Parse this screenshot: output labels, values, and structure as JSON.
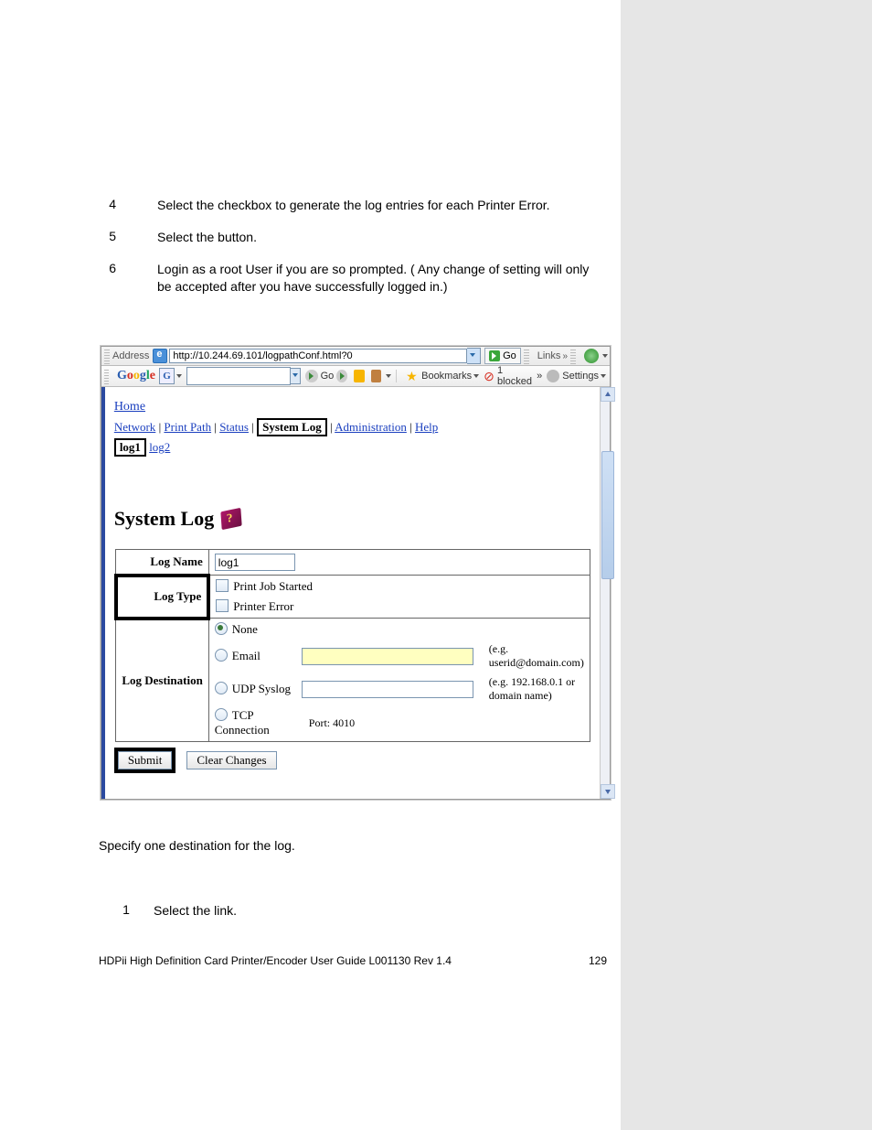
{
  "steps": [
    {
      "num": "4",
      "text_a": "Select the ",
      "text_b": " checkbox to generate the log entries for each Printer Error."
    },
    {
      "num": "5",
      "text_a": "Select the ",
      "text_b": " button."
    },
    {
      "num": "6",
      "text_a": "Login as a root User if you are so prompted. (",
      "text_b": " Any change of setting will only be accepted after you have successfully logged in.)"
    }
  ],
  "browser": {
    "address_label": "Address",
    "url": "http://10.244.69.101/logpathConf.html?0",
    "go": "Go",
    "links": "Links",
    "google": {
      "g": "G",
      "o1": "o",
      "o2": "o",
      "g2": "g",
      "l": "l",
      "e": "e"
    },
    "toolbar": {
      "go": "Go",
      "bookmarks": "Bookmarks",
      "blocked": "1 blocked",
      "settings": "Settings"
    }
  },
  "page": {
    "home": "Home",
    "nav": {
      "network": "Network",
      "printpath": "Print Path",
      "status": "Status",
      "systemlog": "System Log",
      "admin": "Administration",
      "help": "Help"
    },
    "sub": {
      "log1": "log1",
      "log2": "log2"
    },
    "title": "System Log",
    "logname": {
      "label": "Log Name",
      "value": "log1"
    },
    "logtype": {
      "label": "Log Type",
      "opt1": "Print Job Started",
      "opt2": "Printer Error"
    },
    "logdest": {
      "label": "Log Destination",
      "none": "None",
      "email": "Email",
      "email_hint": "(e.g. userid@domain.com)",
      "udp": "UDP Syslog",
      "udp_hint": "(e.g. 192.168.0.1 or domain name)",
      "tcp": "TCP Connection",
      "port": "Port: 4010"
    },
    "submit": "Submit",
    "clear": "Clear Changes"
  },
  "after": {
    "intro": "Specify one destination for the log.",
    "steps": [
      {
        "num": "1",
        "text_a": "Select the ",
        "text_b": " link."
      }
    ]
  },
  "footer": {
    "left": "HDPii High Definition Card Printer/Encoder User Guide    L001130 Rev 1.4",
    "right": "129"
  }
}
